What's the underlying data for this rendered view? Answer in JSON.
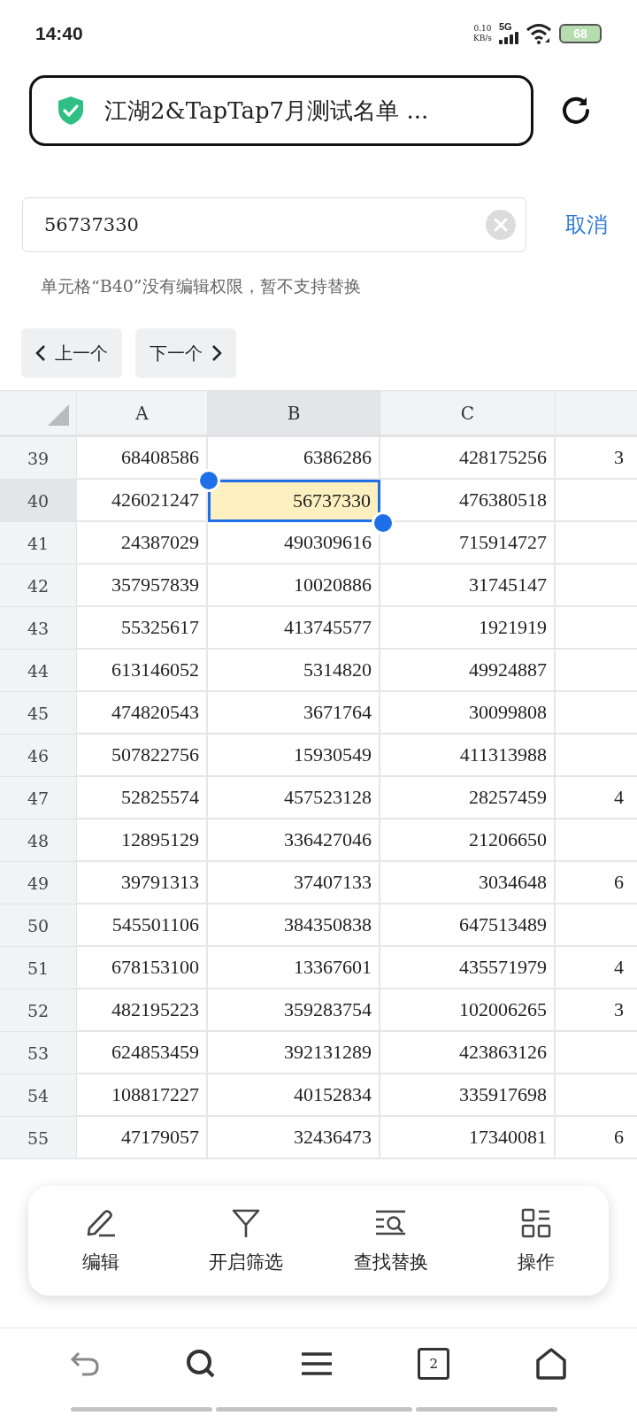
{
  "status_bar": {
    "time": "14:40",
    "speed": "0.10",
    "speed_unit": "KB/s",
    "network": "5G",
    "battery": "68"
  },
  "title_bar": {
    "title": "江湖2&TapTap7月测试名单 ..."
  },
  "search": {
    "value": "56737330",
    "cancel": "取消",
    "message": "单元格“B40”没有编辑权限，暂不支持替换"
  },
  "nav_buttons": [
    {
      "label": "上一个",
      "kind": "prev"
    },
    {
      "label": "下一个",
      "kind": "next"
    }
  ],
  "table": {
    "columns": [
      {
        "label": "A",
        "selected": false
      },
      {
        "label": "B",
        "selected": true
      },
      {
        "label": "C",
        "selected": false
      }
    ],
    "rows": [
      {
        "number": "39",
        "selected": false,
        "cells": [
          "68408586",
          "6386286",
          "428175256",
          "3"
        ]
      },
      {
        "number": "40",
        "selected": true,
        "cells": [
          "426021247",
          "56737330",
          "476380518",
          ""
        ]
      },
      {
        "number": "41",
        "selected": false,
        "cells": [
          "24387029",
          "490309616",
          "715914727",
          ""
        ]
      },
      {
        "number": "42",
        "selected": false,
        "cells": [
          "357957839",
          "10020886",
          "31745147",
          ""
        ]
      },
      {
        "number": "43",
        "selected": false,
        "cells": [
          "55325617",
          "413745577",
          "1921919",
          ""
        ]
      },
      {
        "number": "44",
        "selected": false,
        "cells": [
          "613146052",
          "5314820",
          "49924887",
          ""
        ]
      },
      {
        "number": "45",
        "selected": false,
        "cells": [
          "474820543",
          "3671764",
          "30099808",
          ""
        ]
      },
      {
        "number": "46",
        "selected": false,
        "cells": [
          "507822756",
          "15930549",
          "411313988",
          ""
        ]
      },
      {
        "number": "47",
        "selected": false,
        "cells": [
          "52825574",
          "457523128",
          "28257459",
          "4"
        ]
      },
      {
        "number": "48",
        "selected": false,
        "cells": [
          "12895129",
          "336427046",
          "21206650",
          ""
        ]
      },
      {
        "number": "49",
        "selected": false,
        "cells": [
          "39791313",
          "37407133",
          "3034648",
          "6"
        ]
      },
      {
        "number": "50",
        "selected": false,
        "cells": [
          "545501106",
          "384350838",
          "647513489",
          ""
        ]
      },
      {
        "number": "51",
        "selected": false,
        "cells": [
          "678153100",
          "13367601",
          "435571979",
          "4"
        ]
      },
      {
        "number": "52",
        "selected": false,
        "cells": [
          "482195223",
          "359283754",
          "102006265",
          "3"
        ]
      },
      {
        "number": "53",
        "selected": false,
        "cells": [
          "624853459",
          "392131289",
          "423863126",
          ""
        ]
      },
      {
        "number": "54",
        "selected": false,
        "cells": [
          "108817227",
          "40152834",
          "335917698",
          ""
        ]
      },
      {
        "number": "55",
        "selected": false,
        "cells": [
          "47179057",
          "32436473",
          "17340081",
          "6"
        ]
      }
    ]
  },
  "toolbar": [
    {
      "label": "编辑",
      "kind": "edit"
    },
    {
      "label": "开启筛选",
      "kind": "filter"
    },
    {
      "label": "查找替换",
      "kind": "find"
    },
    {
      "label": "操作",
      "kind": "ops"
    }
  ],
  "bottom_nav": [
    {
      "kind": "back"
    },
    {
      "kind": "search"
    },
    {
      "kind": "menu"
    },
    {
      "kind": "tabs",
      "label": "2"
    },
    {
      "kind": "home"
    }
  ]
}
